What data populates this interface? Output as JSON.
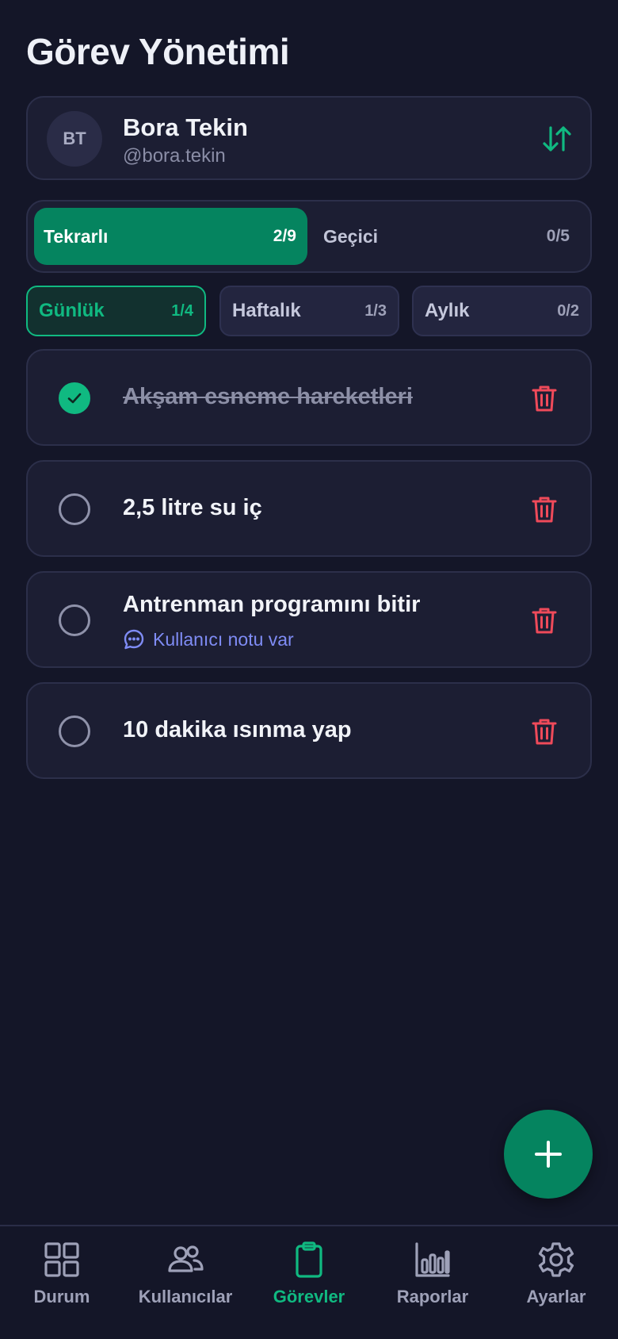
{
  "page": {
    "title": "Görev Yönetimi"
  },
  "user": {
    "initials": "BT",
    "name": "Bora Tekin",
    "handle": "@bora.tekin",
    "switch_icon": "swap-vertical-icon"
  },
  "type_tabs": [
    {
      "label": "Tekrarlı",
      "count": "2/9",
      "active": true
    },
    {
      "label": "Geçici",
      "count": "0/5",
      "active": false
    }
  ],
  "period_tabs": [
    {
      "label": "Günlük",
      "count": "1/4",
      "active": true
    },
    {
      "label": "Haftalık",
      "count": "1/3",
      "active": false
    },
    {
      "label": "Aylık",
      "count": "0/2",
      "active": false
    }
  ],
  "tasks": [
    {
      "title": "Akşam esneme hareketleri",
      "done": true,
      "note": ""
    },
    {
      "title": "2,5 litre su iç",
      "done": false,
      "note": ""
    },
    {
      "title": "Antrenman programını bitir",
      "done": false,
      "note": "Kullanıcı notu var"
    },
    {
      "title": "10 dakika ısınma yap",
      "done": false,
      "note": ""
    }
  ],
  "fab": {
    "icon": "plus-icon"
  },
  "nav": [
    {
      "label": "Durum",
      "icon": "grid-icon",
      "active": false
    },
    {
      "label": "Kullanıcılar",
      "icon": "users-icon",
      "active": false
    },
    {
      "label": "Görevler",
      "icon": "clipboard-icon",
      "active": true
    },
    {
      "label": "Raporlar",
      "icon": "bar-chart-icon",
      "active": false
    },
    {
      "label": "Ayarlar",
      "icon": "gear-icon",
      "active": false
    }
  ],
  "colors": {
    "background": "#141628",
    "card": "#1c1e33",
    "accent": "#10b981",
    "accent_dark": "#05845f",
    "danger": "#ef4a5a",
    "note": "#7f8cf5"
  }
}
